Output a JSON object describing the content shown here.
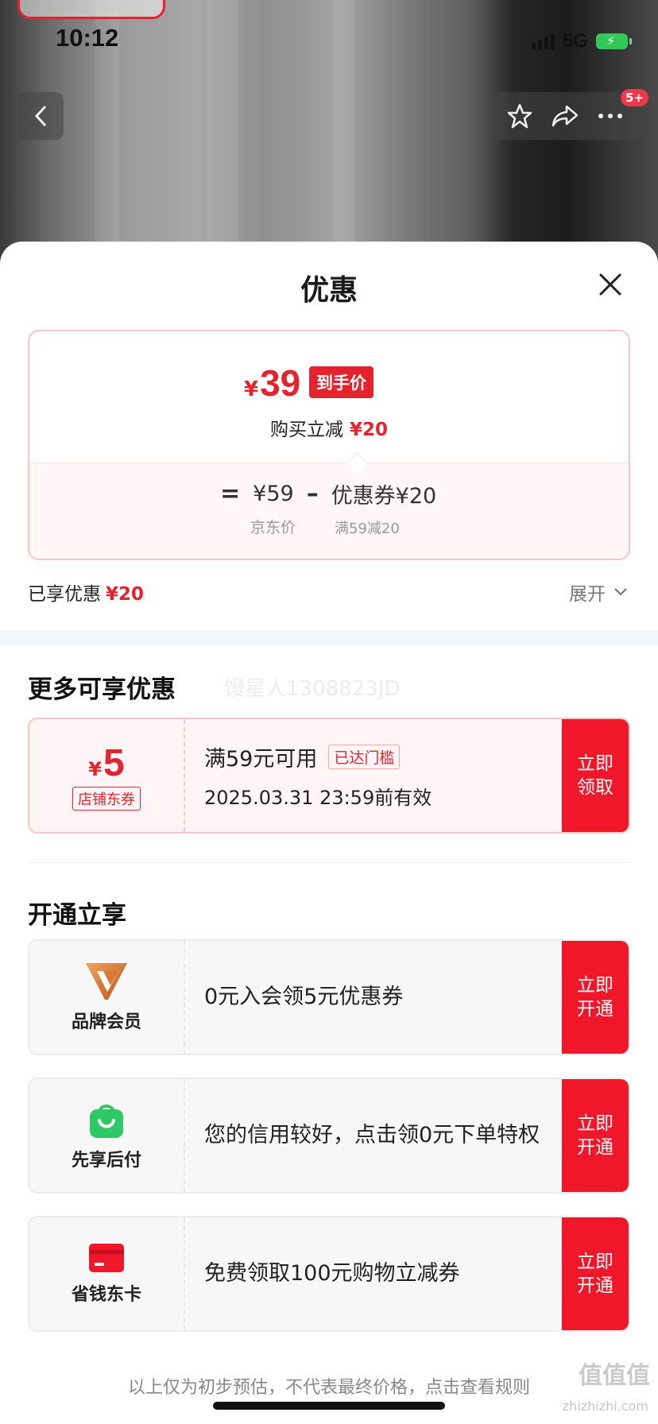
{
  "status_bar": {
    "time": "10:12",
    "network": "5G"
  },
  "header": {
    "message_badge": "5+"
  },
  "sheet": {
    "title": "优惠"
  },
  "price_card": {
    "currency": "¥",
    "final_price": "39",
    "final_tag": "到手价",
    "discount_label": "购买立减",
    "discount_amount": "¥20",
    "calc": {
      "equals": "=",
      "jd_price": "¥59",
      "minus": "–",
      "coupon_part": "优惠券¥20",
      "jd_price_label": "京东价",
      "coupon_rule": "满59减20"
    }
  },
  "enjoyed": {
    "label": "已享优惠",
    "amount": "¥20",
    "expand_label": "展开"
  },
  "more_offers": {
    "title": "更多可享优惠",
    "watermark": "馒星人1308823JD",
    "coupon": {
      "currency": "¥",
      "value": "5",
      "type": "店铺东券",
      "condition": "满59元可用",
      "reached_tag": "已达门槛",
      "valid_until": "2025.03.31 23:59前有效",
      "cta_line1": "立即",
      "cta_line2": "领取"
    }
  },
  "open_section": {
    "title": "开通立享",
    "items": [
      {
        "icon": "brand-member-v-icon",
        "label": "品牌会员",
        "text": "0元入会领5元优惠券",
        "cta_line1": "立即",
        "cta_line2": "开通"
      },
      {
        "icon": "shopping-bag-icon",
        "label": "先享后付",
        "text": "您的信用较好，点击领0元下单特权",
        "cta_line1": "立即",
        "cta_line2": "开通"
      },
      {
        "icon": "card-icon",
        "label": "省钱东卡",
        "text": "免费领取100元购物立减券",
        "cta_line1": "立即",
        "cta_line2": "开通"
      }
    ]
  },
  "footer": {
    "note": "以上仅为初步预估，不代表最终价格，点击查看规则",
    "site_mark": "值值值",
    "site_url": "zhizhizhi.com"
  },
  "colors": {
    "accent": "#e4232f",
    "cta": "#f1172a",
    "green": "#2ec866"
  }
}
